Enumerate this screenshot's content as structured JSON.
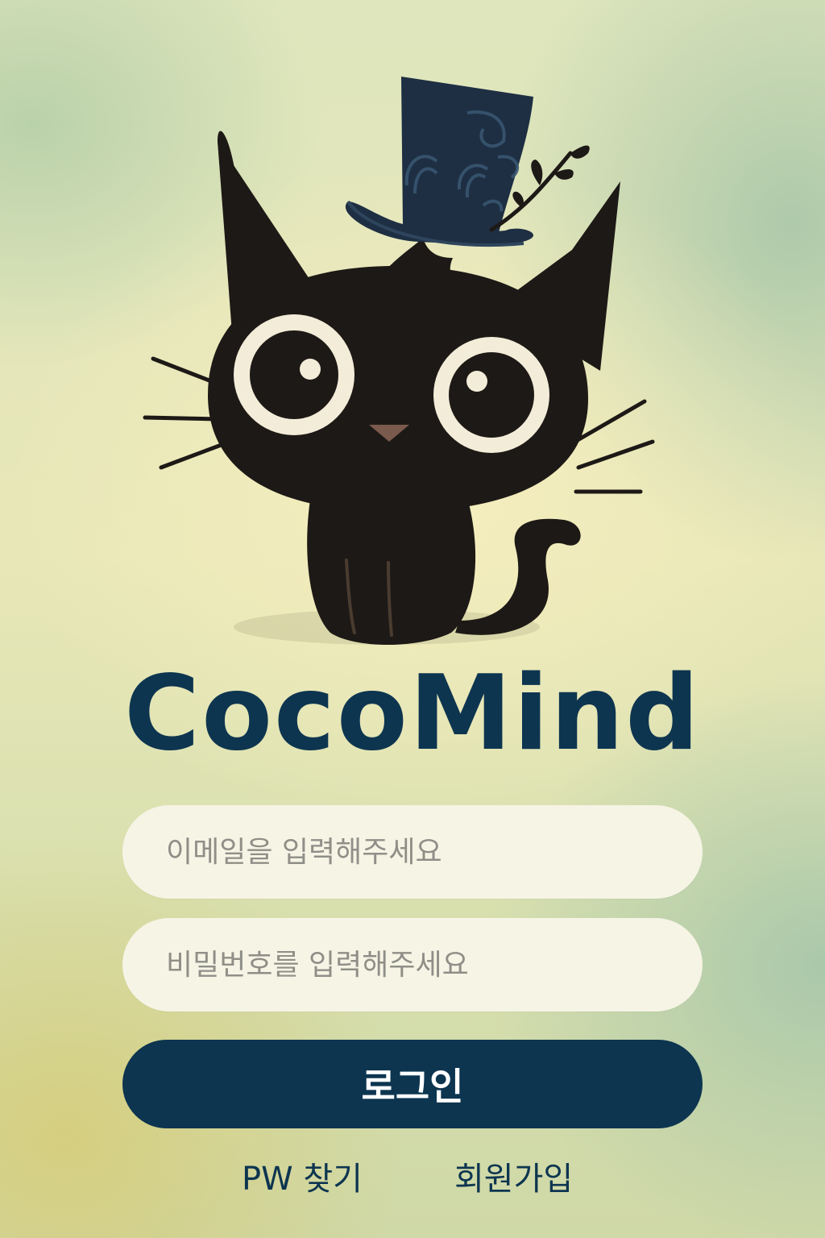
{
  "app": {
    "title": "CocoMind"
  },
  "colors": {
    "brand": "#0d3550",
    "field_bg": "#f6f4e5",
    "placeholder": "#8f8f88"
  },
  "mascot": {
    "icon": "black-cat-top-hat-icon"
  },
  "form": {
    "email_placeholder": "이메일을 입력해주세요",
    "email_value": "",
    "password_placeholder": "비밀번호를 입력해주세요",
    "password_value": "",
    "login_label": "로그인"
  },
  "links": {
    "find_pw": "PW 찾기",
    "sign_up": "회원가입"
  }
}
